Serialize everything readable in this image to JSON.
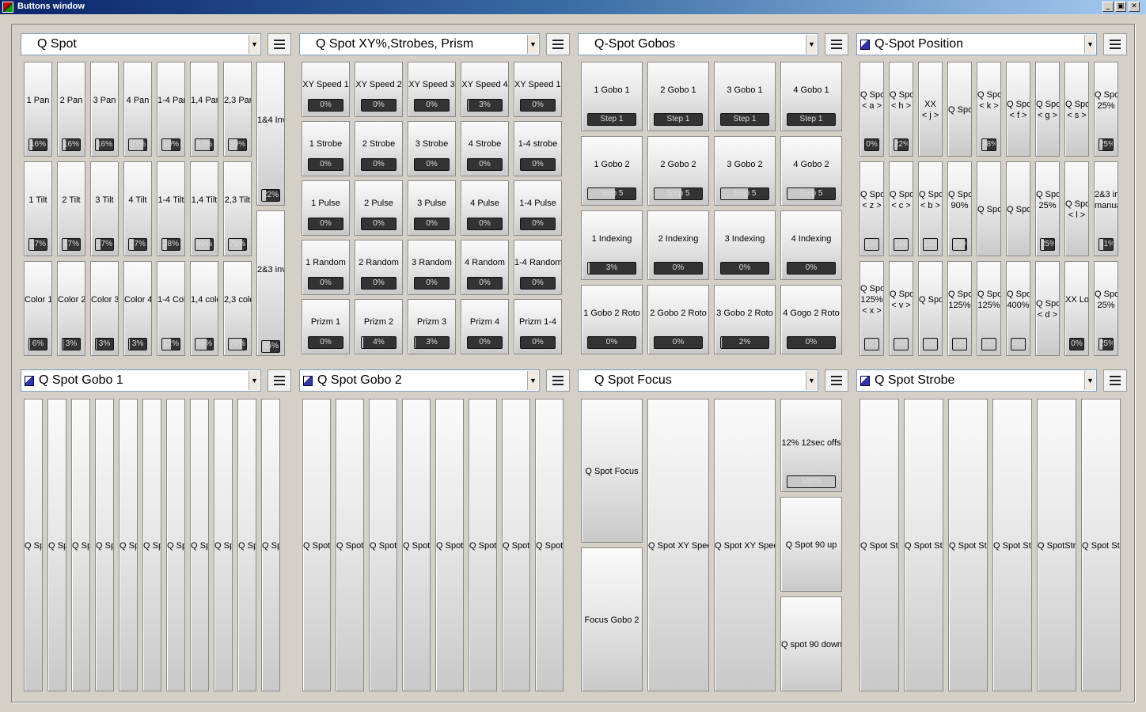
{
  "window": {
    "title": "Buttons window",
    "min": "_",
    "max": "▣",
    "close": "✕"
  },
  "colors": {
    "titlebar": "#0a246a",
    "face": "#d4d0c8",
    "indicator": "#333333",
    "indicator_fill": "#c8c8c8"
  },
  "panels": [
    {
      "title": "Q Spot",
      "icon": false,
      "buttons": [
        {
          "label": "1 Pan",
          "value": "16%",
          "fill": 0.16
        },
        {
          "label": "2 Pan",
          "value": "16%",
          "fill": 0.16
        },
        {
          "label": "3 Pan",
          "value": "16%",
          "fill": 0.16
        },
        {
          "label": "4 Pan",
          "value": "83%",
          "fill": 0.83
        },
        {
          "label": "1-4 Pan",
          "value": "50%",
          "fill": 0.5
        },
        {
          "label": "1,4 Pan",
          "value": "83%",
          "fill": 0.83
        },
        {
          "label": "2,3 Pan",
          "value": "50%",
          "fill": 0.5
        },
        {
          "label": "1&4 Inv",
          "value": "22%",
          "fill": 0.22
        },
        {
          "label": "1 Tilt",
          "value": "27%",
          "fill": 0.27
        },
        {
          "label": "2 Tilt",
          "value": "27%",
          "fill": 0.27
        },
        {
          "label": "3 Tilt",
          "value": "27%",
          "fill": 0.27
        },
        {
          "label": "4 Tilt",
          "value": "27%",
          "fill": 0.27
        },
        {
          "label": "1-4 Tilt",
          "value": "28%",
          "fill": 0.28
        },
        {
          "label": "1,4 Tilt",
          "value": "80%",
          "fill": 0.8
        },
        {
          "label": "2,3 Tilt",
          "value": "75%",
          "fill": 0.75
        },
        {
          "label": "Color 1",
          "value": "6%",
          "fill": 0.06
        },
        {
          "label": "Color 2",
          "value": "3%",
          "fill": 0.03
        },
        {
          "label": "Color 3",
          "value": "3%",
          "fill": 0.03
        },
        {
          "label": "Color 4",
          "value": "3%",
          "fill": 0.03
        },
        {
          "label": "1-4 Col",
          "value": "52%",
          "fill": 0.52
        },
        {
          "label": "1,4 colo",
          "value": "65%",
          "fill": 0.65
        },
        {
          "label": "2,3 colo",
          "value": "78%",
          "fill": 0.78
        },
        {
          "label": "2&3 inv",
          "value": "45%",
          "fill": 0.45
        }
      ]
    },
    {
      "title": "Q Spot XY%,Strobes, Prism",
      "icon": false,
      "buttons": [
        {
          "label": "XY Speed 1",
          "value": "0%",
          "fill": 0
        },
        {
          "label": "XY Speed 2",
          "value": "0%",
          "fill": 0
        },
        {
          "label": "XY Speed 3",
          "value": "0%",
          "fill": 0
        },
        {
          "label": "XY Speed 4",
          "value": "3%",
          "fill": 0.03
        },
        {
          "label": "XY Speed 1-",
          "value": "0%",
          "fill": 0
        },
        {
          "label": "1 Strobe",
          "value": "0%",
          "fill": 0
        },
        {
          "label": "2 Strobe",
          "value": "0%",
          "fill": 0
        },
        {
          "label": "3 Strobe",
          "value": "0%",
          "fill": 0
        },
        {
          "label": "4 Strobe",
          "value": "0%",
          "fill": 0
        },
        {
          "label": "1-4 strobe",
          "value": "0%",
          "fill": 0
        },
        {
          "label": "1 Pulse",
          "value": "0%",
          "fill": 0
        },
        {
          "label": "2 Pulse",
          "value": "0%",
          "fill": 0
        },
        {
          "label": "3 Pulse",
          "value": "0%",
          "fill": 0
        },
        {
          "label": "4 Pulse",
          "value": "0%",
          "fill": 0
        },
        {
          "label": "1-4 Pulse",
          "value": "0%",
          "fill": 0
        },
        {
          "label": "1 Random",
          "value": "0%",
          "fill": 0
        },
        {
          "label": "2 Random",
          "value": "0%",
          "fill": 0
        },
        {
          "label": "3 Random",
          "value": "0%",
          "fill": 0
        },
        {
          "label": "4 Random",
          "value": "0%",
          "fill": 0
        },
        {
          "label": "1-4 Random",
          "value": "0%",
          "fill": 0
        },
        {
          "label": "Prizm 1",
          "value": "0%",
          "fill": 0
        },
        {
          "label": "Prizm 2",
          "value": "4%",
          "fill": 0.04
        },
        {
          "label": "Prizm 3",
          "value": "3%",
          "fill": 0.03
        },
        {
          "label": "Prizm 4",
          "value": "0%",
          "fill": 0
        },
        {
          "label": "Prizm 1-4",
          "value": "0%",
          "fill": 0
        }
      ]
    },
    {
      "title": "Q-Spot Gobos",
      "icon": false,
      "buttons": [
        {
          "label": "1 Gobo 1",
          "value": "Step 1",
          "fill": 0
        },
        {
          "label": "2 Gobo 1",
          "value": "Step 1",
          "fill": 0
        },
        {
          "label": "3 Gobo 1",
          "value": "Step 1",
          "fill": 0
        },
        {
          "label": "4 Gobo 1",
          "value": "Step 1",
          "fill": 0
        },
        {
          "label": "1 Gobo 2",
          "value": "Step 5",
          "fill": 0.57
        },
        {
          "label": "2 Gobo 2",
          "value": "Step 5",
          "fill": 0.57
        },
        {
          "label": "3 Gobo 2",
          "value": "Step 5",
          "fill": 0.57
        },
        {
          "label": "4 Gobo 2",
          "value": "Step 5",
          "fill": 0.57
        },
        {
          "label": "1 Indexing",
          "value": "3%",
          "fill": 0.03
        },
        {
          "label": "2 Indexing",
          "value": "0%",
          "fill": 0
        },
        {
          "label": "3 Indexing",
          "value": "0%",
          "fill": 0
        },
        {
          "label": "4 Indexing",
          "value": "0%",
          "fill": 0
        },
        {
          "label": "1 Gobo 2 Roto",
          "value": "0%",
          "fill": 0
        },
        {
          "label": "2 Gobo 2 Roto",
          "value": "0%",
          "fill": 0
        },
        {
          "label": "3 Gobo 2 Roto",
          "value": "2%",
          "fill": 0.02
        },
        {
          "label": "4 Gogo 2 Roto",
          "value": "0%",
          "fill": 0
        }
      ]
    },
    {
      "title": "Q-Spot Position",
      "icon": true,
      "buttons": [
        {
          "label": "Q Spot\n< a >",
          "value": "0%",
          "fill": 0
        },
        {
          "label": "Q Spot\n< h >",
          "value": "22%",
          "fill": 0.22
        },
        {
          "label": "XX\n< j >",
          "value": null
        },
        {
          "label": "Q Spot",
          "value": null
        },
        {
          "label": "Q Spot\n< k >",
          "value": "38%",
          "fill": 0.38
        },
        {
          "label": "Q Spot\n< f >",
          "value": null
        },
        {
          "label": "Q Spot\n< g >",
          "value": null
        },
        {
          "label": "Q Spot\n< s >",
          "value": null
        },
        {
          "label": "Q Spot\n25%",
          "value": "25%",
          "fill": 0.25
        },
        {
          "label": "Q Spot\n< z >",
          "value": "100%",
          "fill": 1
        },
        {
          "label": "Q Spot\n< c >",
          "value": "100%",
          "fill": 1
        },
        {
          "label": "Q Spot\n< b >",
          "value": "100%",
          "fill": 1
        },
        {
          "label": "Q Spot\n90%",
          "value": "90%",
          "fill": 0.9
        },
        {
          "label": "Q Spot",
          "value": null
        },
        {
          "label": "Q Spot",
          "value": null
        },
        {
          "label": "Q Spot\n25%",
          "value": "25%",
          "fill": 0.25
        },
        {
          "label": "Q Spot\n< l >",
          "value": null
        },
        {
          "label": "2&3 in\nmanua",
          "value": "31%",
          "fill": 0.31
        },
        {
          "label": "Q Spot\n125%\n< x >",
          "value": "125%",
          "fill": 1
        },
        {
          "label": "Q Spot\n< v >",
          "value": "100%",
          "fill": 1
        },
        {
          "label": "Q Spot",
          "value": "100%",
          "fill": 1
        },
        {
          "label": "Q Spot\n125%",
          "value": "125%",
          "fill": 1
        },
        {
          "label": "Q Spot\n125%",
          "value": "125%",
          "fill": 1
        },
        {
          "label": "Q Spot\n400%",
          "value": "400%",
          "fill": 1
        },
        {
          "label": "Q Spot\n< d >",
          "value": null
        },
        {
          "label": "XX Lo",
          "value": "0%",
          "fill": 0
        },
        {
          "label": "Q Spot\n25%",
          "value": "25%",
          "fill": 0.25
        }
      ]
    },
    {
      "title": "Q Spot Gobo 1",
      "icon": true,
      "buttons": [
        {
          "label": "Q Sp"
        },
        {
          "label": "Q Sp"
        },
        {
          "label": "Q Sp"
        },
        {
          "label": "Q Sp"
        },
        {
          "label": "Q Sp"
        },
        {
          "label": "Q Sp"
        },
        {
          "label": "Q Sp"
        },
        {
          "label": "Q Sp"
        },
        {
          "label": "Q Sp"
        },
        {
          "label": "Q Sp"
        },
        {
          "label": "Q Sp"
        }
      ]
    },
    {
      "title": "Q Spot Gobo 2",
      "icon": true,
      "buttons": [
        {
          "label": "Q Spot"
        },
        {
          "label": "Q Spot"
        },
        {
          "label": "Q Spot"
        },
        {
          "label": "Q Spot"
        },
        {
          "label": "Q Spot"
        },
        {
          "label": "Q Spot"
        },
        {
          "label": "Q Spot"
        },
        {
          "label": "Q Spot"
        }
      ]
    },
    {
      "title": "Q Spot Focus",
      "icon": false,
      "buttons": [
        {
          "label": "Q Spot Focus"
        },
        {
          "label": "Focus Gobo 2"
        },
        {
          "label": "Q Spot XY Spee"
        },
        {
          "label": "Q Spot XY Spee"
        },
        {
          "label": "12% 12sec offs",
          "value": "100%",
          "fill": 1
        },
        {
          "label": "Q Spot 90 up"
        },
        {
          "label": "Q spot 90 down"
        }
      ]
    },
    {
      "title": "Q Spot Strobe",
      "icon": true,
      "buttons": [
        {
          "label": "Q Spot Str"
        },
        {
          "label": "Q Spot Str"
        },
        {
          "label": "Q Spot Str"
        },
        {
          "label": "Q Spot Str"
        },
        {
          "label": "Q SpotStr"
        },
        {
          "label": "Q Spot Str"
        }
      ]
    }
  ]
}
